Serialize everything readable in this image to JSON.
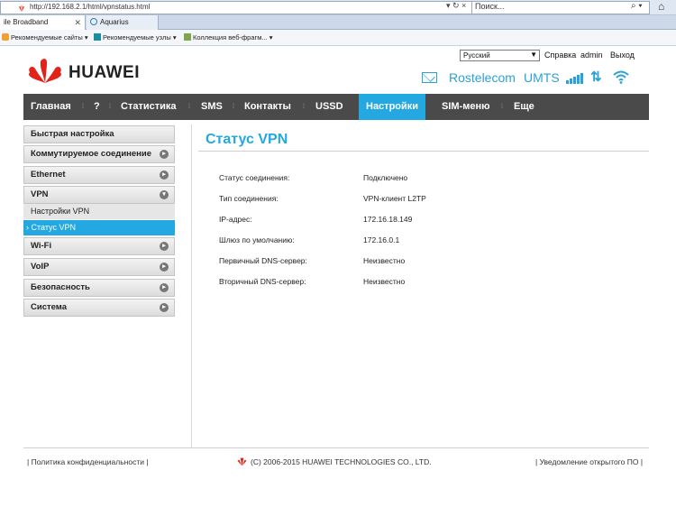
{
  "browser": {
    "url": "http://192.168.2.1/html/vpnstatus.html",
    "search_placeholder": "Поиск...",
    "tabs": [
      {
        "label": "ile Broadband"
      },
      {
        "label": "Aquarius"
      }
    ],
    "favorites": [
      {
        "label": "Рекомендуемые сайты ▾"
      },
      {
        "label": "Рекомендуемые узлы ▾"
      },
      {
        "label": "Коллекция веб-фрагм... ▾"
      }
    ]
  },
  "header": {
    "brand": "HUAWEI",
    "language": "Русский",
    "links": {
      "help": "Справка",
      "user": "admin",
      "logout": "Выход"
    },
    "operator": "Rostelecom",
    "network_type": "UMTS",
    "signal_level_of_5": 5
  },
  "nav": {
    "items": [
      {
        "label": "Главная"
      },
      {
        "label": "?"
      },
      {
        "label": "Статистика"
      },
      {
        "label": "SMS"
      },
      {
        "label": "Контакты"
      },
      {
        "label": "USSD"
      },
      {
        "label": "Настройки"
      },
      {
        "label": "SIM-меню"
      },
      {
        "label": "Еще"
      }
    ],
    "active": "Настройки"
  },
  "sidebar": {
    "items": [
      {
        "label": "Быстрая настройка"
      },
      {
        "label": "Коммутируемое соединение"
      },
      {
        "label": "Ethernet"
      },
      {
        "label": "VPN"
      },
      {
        "label": "Wi-Fi"
      },
      {
        "label": "VoIP"
      },
      {
        "label": "Безопасность"
      },
      {
        "label": "Система"
      }
    ],
    "vpn_sub": [
      {
        "label": "Настройки VPN"
      },
      {
        "label": "Статус VPN"
      }
    ]
  },
  "main": {
    "title": "Статус VPN",
    "rows": [
      {
        "label": "Статус соединения:",
        "value": "Подключено"
      },
      {
        "label": "Тип соединения:",
        "value": "VPN-клиент L2TP"
      },
      {
        "label": "IP-адрес:",
        "value": "172.16.18.149"
      },
      {
        "label": "Шлюз по умолчанию:",
        "value": "172.16.0.1"
      },
      {
        "label": "Первичный DNS-сервер:",
        "value": "Неизвестно"
      },
      {
        "label": "Вторичный DNS-сервер:",
        "value": "Неизвестно"
      }
    ]
  },
  "footer": {
    "privacy": "Политика конфиденциальности",
    "copyright": "(C) 2006-2015 HUAWEI TECHNOLOGIES CO., LTD.",
    "open_source": "Уведомление открытого ПО"
  },
  "colors": {
    "accent": "#23a8e2",
    "navbar": "#4a4a4a",
    "brand_red": "#e2231a"
  }
}
